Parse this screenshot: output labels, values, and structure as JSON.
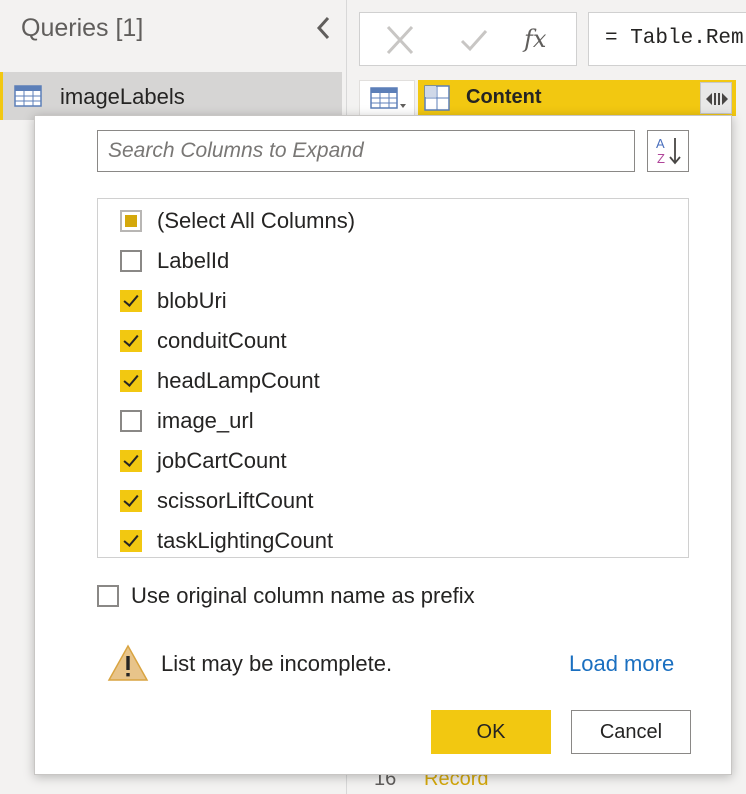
{
  "queries_pane": {
    "title": "Queries [1]",
    "items": [
      {
        "label": "imageLabels",
        "icon": "table-icon"
      }
    ]
  },
  "formula_bar": {
    "formula_text": "= Table.Rem",
    "fx_label": "fx"
  },
  "grid": {
    "column_header": "Content",
    "row_number": "16",
    "row_value": "Record"
  },
  "expand_dialog": {
    "search_placeholder": "Search Columns to Expand",
    "select_all_label": "(Select All Columns)",
    "columns": [
      {
        "label": "LabelId",
        "checked": false
      },
      {
        "label": "blobUri",
        "checked": true
      },
      {
        "label": "conduitCount",
        "checked": true
      },
      {
        "label": "headLampCount",
        "checked": true
      },
      {
        "label": "image_url",
        "checked": false
      },
      {
        "label": "jobCartCount",
        "checked": true
      },
      {
        "label": "scissorLiftCount",
        "checked": true
      },
      {
        "label": "taskLightingCount",
        "checked": true
      }
    ],
    "prefix_label": "Use original column name as prefix",
    "prefix_checked": false,
    "warning_text": "List may be incomplete.",
    "load_more_label": "Load more",
    "ok_label": "OK",
    "cancel_label": "Cancel"
  },
  "colors": {
    "accent": "#f2c811",
    "link": "#1a6fc0"
  }
}
